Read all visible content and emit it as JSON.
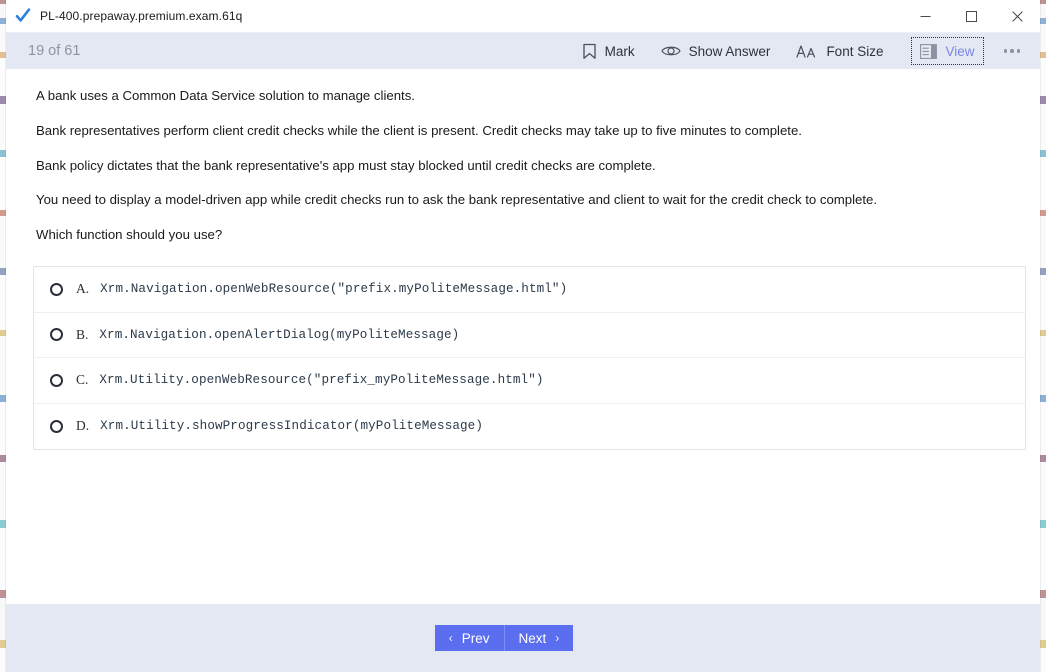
{
  "window": {
    "title": "PL-400.prepaway.premium.exam.61q",
    "app_icon": "blue-checkmark-icon",
    "controls": {
      "minimize": "minimize-icon",
      "maximize": "maximize-icon",
      "close": "close-icon"
    }
  },
  "toolbar": {
    "counter": "19 of 61",
    "current_question": 19,
    "total_questions": 61,
    "buttons": [
      {
        "label": "Mark",
        "icon": "bookmark-icon"
      },
      {
        "label": "Show Answer",
        "icon": "eye-icon"
      },
      {
        "label": "Font Size",
        "icon": "font-size-icon"
      },
      {
        "label": "View",
        "icon": "layout-panel-icon",
        "focused": true
      }
    ],
    "more_label": "more-options-icon"
  },
  "question": {
    "stem": [
      "A bank uses a Common Data Service solution to manage clients.",
      "Bank representatives perform client credit checks while the client is present. Credit checks may take up to five minutes to complete.",
      "Bank policy dictates that the bank representative's app must stay blocked until credit checks are complete.",
      "You need to display a model-driven app while credit checks run to ask the bank representative and client to wait for the credit check to complete.",
      "Which function should you use?"
    ],
    "options": [
      {
        "letter": "A.",
        "code": "Xrm.Navigation.openWebResource(\"prefix.myPoliteMessage.html\")",
        "selected": false
      },
      {
        "letter": "B.",
        "code": "Xrm.Navigation.openAlertDialog(myPoliteMessage)",
        "selected": false
      },
      {
        "letter": "C.",
        "code": "Xrm.Utility.openWebResource(\"prefix_myPoliteMessage.html\")",
        "selected": false
      },
      {
        "letter": "D.",
        "code": "Xrm.Utility.showProgressIndicator(myPoliteMessage)",
        "selected": false
      }
    ]
  },
  "footer": {
    "prev_label": "Prev",
    "next_label": "Next",
    "prev_chevron": "‹",
    "next_chevron": "›"
  },
  "colors": {
    "toolbar_bg": "#e3e8f2",
    "accent_blue": "#5b6ef0",
    "view_blue": "#7b86e8",
    "counter_gray": "#8e93a0",
    "option_border": "#dfe3ea"
  }
}
